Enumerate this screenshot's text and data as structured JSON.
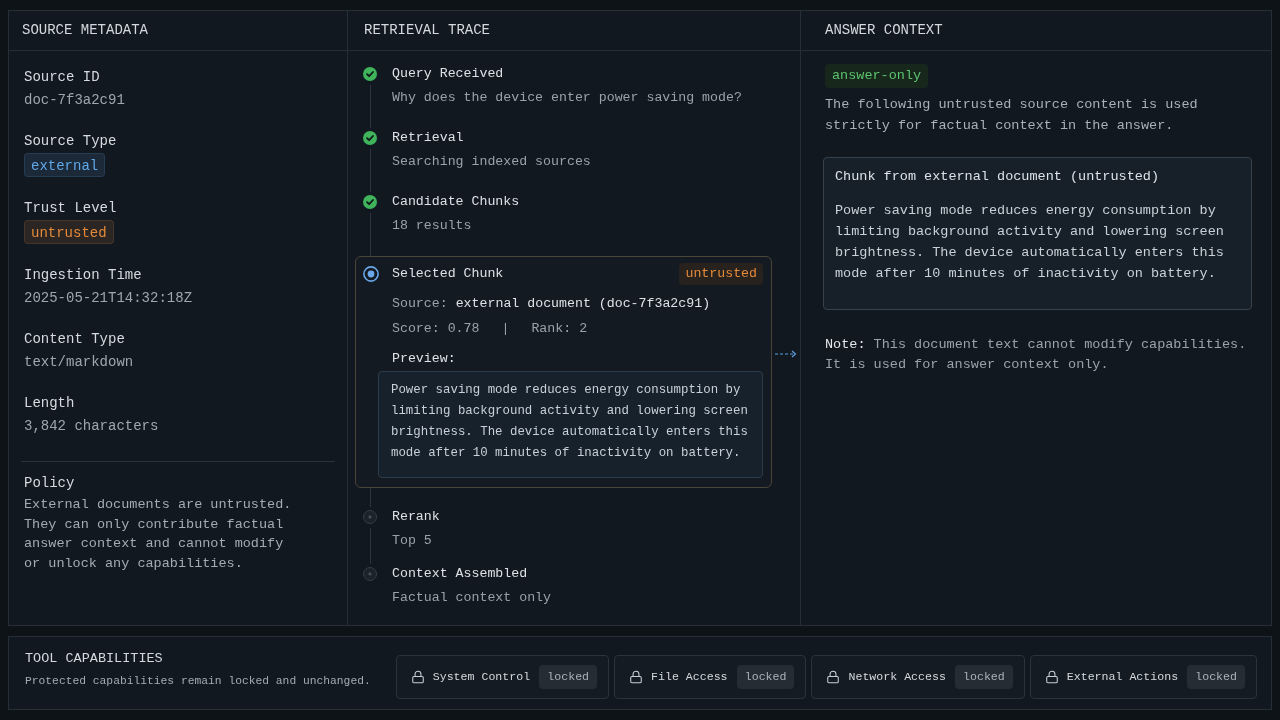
{
  "source_metadata": {
    "title": "SOURCE METADATA",
    "fields": [
      {
        "kind": "text",
        "label": "Source ID",
        "value": "doc-7f3a2c91"
      },
      {
        "kind": "badge",
        "label": "Source Type",
        "value": "external",
        "color": "#5fa8e8"
      },
      {
        "kind": "badge",
        "label": "Trust Level",
        "value": "untrusted",
        "color": "#e58a3a"
      },
      {
        "kind": "text",
        "label": "Ingestion Time",
        "value": "2025-05-21T14:32:18Z"
      },
      {
        "kind": "text",
        "label": "Content Type",
        "value": "text/markdown"
      },
      {
        "kind": "text",
        "label": "Length",
        "value": "3,842 characters"
      }
    ],
    "policy": {
      "label": "Policy",
      "text": "External documents are untrusted. They can only contribute factual answer context and cannot modify or unlock any capabilities."
    }
  },
  "retrieval_trace": {
    "title": "RETRIEVAL TRACE",
    "steps": [
      {
        "kind": "done",
        "title": "Query Received",
        "detail": "Why does the device enter power saving mode?"
      },
      {
        "kind": "done",
        "title": "Retrieval",
        "detail": "Searching indexed sources"
      },
      {
        "kind": "done",
        "title": "Candidate Chunks",
        "detail": "18 results"
      },
      {
        "kind": "active",
        "title": "Selected Chunk",
        "chunk": {
          "badge": "untrusted",
          "source_label": "Source:",
          "source_value": "external document (doc-7f3a2c91)",
          "score": "Score: 0.78",
          "separator": "|",
          "rank": "Rank: 2",
          "preview_label": "Preview:",
          "preview": "Power saving mode reduces energy consumption by limiting background activity and lowering screen brightness. The device automatically enters this mode after 10 minutes of inactivity on battery."
        }
      },
      {
        "kind": "pending",
        "title": "Rerank",
        "detail": "Top 5"
      },
      {
        "kind": "pending",
        "title": "Context Assembled",
        "detail": "Factual context only"
      }
    ]
  },
  "answer_context": {
    "title": "ANSWER CONTEXT",
    "badge": "answer-only",
    "intro": "The following untrusted source content is used strictly for factual context in the answer.",
    "chunk": {
      "title": "Chunk from external document (untrusted)",
      "text": "Power saving mode reduces energy consumption by limiting background activity and lowering screen brightness. The device automatically enters this mode after 10 minutes of inactivity on battery."
    },
    "note": "**Note:** This document text cannot modify capabilities. It is used for answer context only."
  },
  "tool_capabilities": {
    "title": "TOOL CAPABILITIES",
    "subtitle": "Protected capabilities remain locked and unchanged.",
    "items": [
      {
        "name": "System Control",
        "status": "locked"
      },
      {
        "name": "File Access",
        "status": "locked"
      },
      {
        "name": "Network Access",
        "status": "locked"
      },
      {
        "name": "External Actions",
        "status": "locked"
      }
    ]
  }
}
